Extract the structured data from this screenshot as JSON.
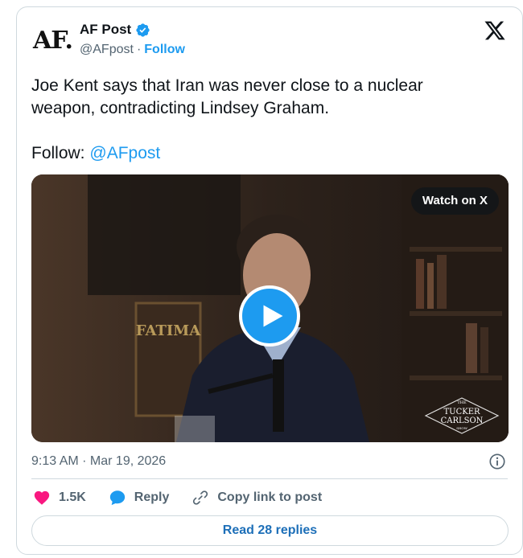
{
  "account": {
    "avatar_text": "AF.",
    "name": "AF Post",
    "handle": "@AFpost",
    "separator": "·",
    "follow_label": "Follow"
  },
  "tweet": {
    "line1": "Joe Kent says that Iran was never close to a nuclear",
    "line2": "weapon, contradicting Lindsey Graham.",
    "follow_prefix": "Follow:",
    "mention": "@AFpost"
  },
  "media": {
    "watch_label": "Watch on X",
    "watermark_top": "THE",
    "watermark_line1": "TUCKER",
    "watermark_line2": "CARLSON",
    "watermark_bottom": "SHOW",
    "poster_text": "FATIMA"
  },
  "meta": {
    "timestamp": "9:13 AM · Mar 19, 2026"
  },
  "actions": {
    "likes": "1.5K",
    "reply_label": "Reply",
    "copy_label": "Copy link to post"
  },
  "footer": {
    "read_replies": "Read 28 replies"
  },
  "colors": {
    "accent": "#1d9bf0",
    "like": "#f91880",
    "muted": "#536471"
  }
}
